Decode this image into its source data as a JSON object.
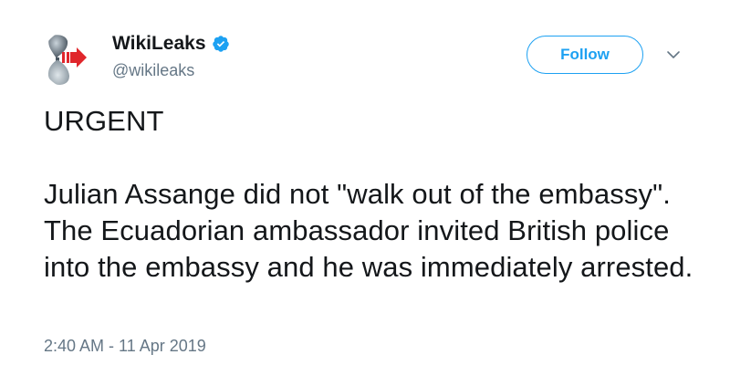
{
  "author": {
    "display_name": "WikiLeaks",
    "handle": "@wikileaks",
    "avatar_icon": "hourglass-logo-icon",
    "verified_icon": "verified-badge-icon"
  },
  "actions": {
    "follow_label": "Follow",
    "more_icon": "chevron-down-icon"
  },
  "tweet": {
    "headline": "URGENT",
    "text": "Julian Assange did not \"walk out of the embassy\". The Ecuadorian ambassador invited British police into the embassy and he was immediately arrested.",
    "timestamp": "2:40 AM - 11 Apr 2019"
  },
  "colors": {
    "accent": "#1da1f2",
    "text_primary": "#14171a",
    "text_secondary": "#657786",
    "arrow_red": "#e0262b"
  }
}
